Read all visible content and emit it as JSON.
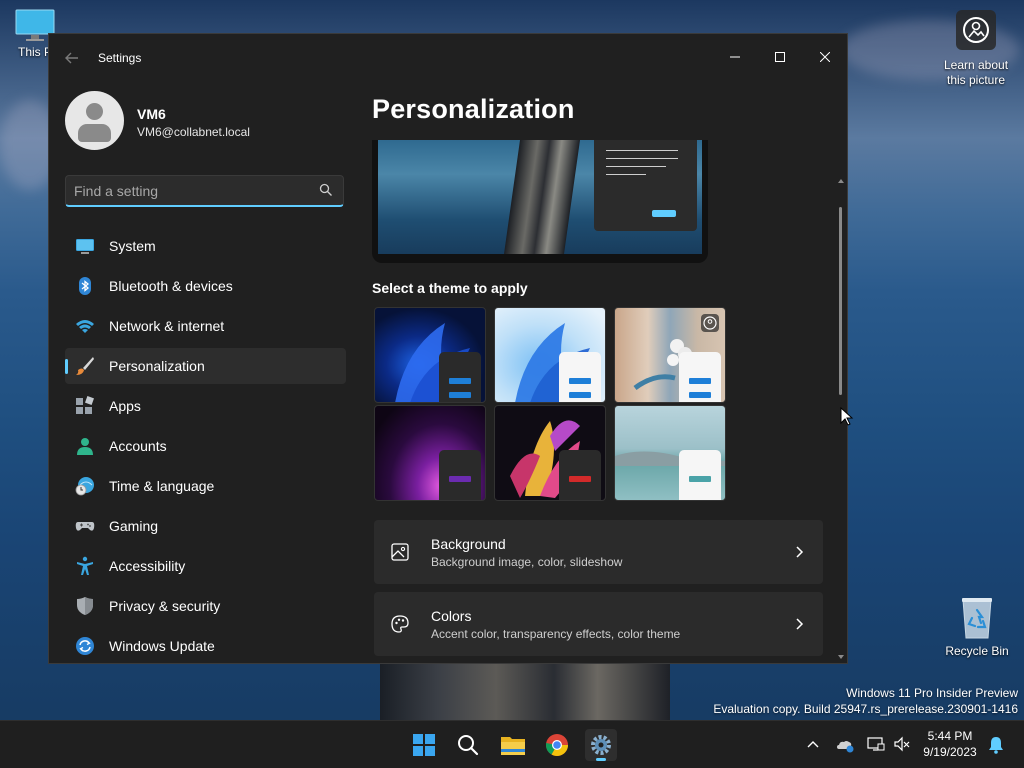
{
  "desktop": {
    "this_pc_label": "This P",
    "learn_label": "Learn about this picture",
    "recycle_bin_label": "Recycle Bin",
    "watermark": {
      "line1": "Windows 11 Pro Insider Preview",
      "line2": "Evaluation copy. Build 25947.rs_prerelease.230901-1416"
    }
  },
  "window": {
    "title": "Settings",
    "controls": {
      "minimize": "—",
      "maximize": "☐",
      "close": "✕"
    }
  },
  "profile": {
    "name": "VM6",
    "email": "VM6@collabnet.local"
  },
  "search": {
    "placeholder": "Find a setting"
  },
  "nav": {
    "items": [
      {
        "label": "System",
        "icon": "system-icon"
      },
      {
        "label": "Bluetooth & devices",
        "icon": "bluetooth-icon"
      },
      {
        "label": "Network & internet",
        "icon": "wifi-icon"
      },
      {
        "label": "Personalization",
        "icon": "brush-icon",
        "active": true
      },
      {
        "label": "Apps",
        "icon": "apps-icon"
      },
      {
        "label": "Accounts",
        "icon": "accounts-icon"
      },
      {
        "label": "Time & language",
        "icon": "time-language-icon"
      },
      {
        "label": "Gaming",
        "icon": "gamepad-icon"
      },
      {
        "label": "Accessibility",
        "icon": "accessibility-icon"
      },
      {
        "label": "Privacy & security",
        "icon": "shield-icon"
      },
      {
        "label": "Windows Update",
        "icon": "update-icon"
      }
    ]
  },
  "main": {
    "page_title": "Personalization",
    "theme_section_label": "Select a theme to apply",
    "themes": [
      {
        "name": "windows-dark-theme"
      },
      {
        "name": "windows-light-theme"
      },
      {
        "name": "windows-spotlight-theme"
      },
      {
        "name": "glow-theme"
      },
      {
        "name": "captured-motion-theme"
      },
      {
        "name": "flow-theme"
      }
    ],
    "settings": [
      {
        "title": "Background",
        "subtitle": "Background image, color, slideshow",
        "icon": "image-icon"
      },
      {
        "title": "Colors",
        "subtitle": "Accent color, transparency effects, color theme",
        "icon": "palette-icon"
      }
    ]
  },
  "taskbar": {
    "time": "5:44 PM",
    "date": "9/19/2023",
    "apps": [
      "start-icon",
      "search-icon",
      "file-explorer-icon",
      "chrome-icon",
      "settings-icon"
    ]
  },
  "colors": {
    "accent": "#60cdff",
    "window_bg": "#202020",
    "card_bg": "#2b2b2b"
  }
}
